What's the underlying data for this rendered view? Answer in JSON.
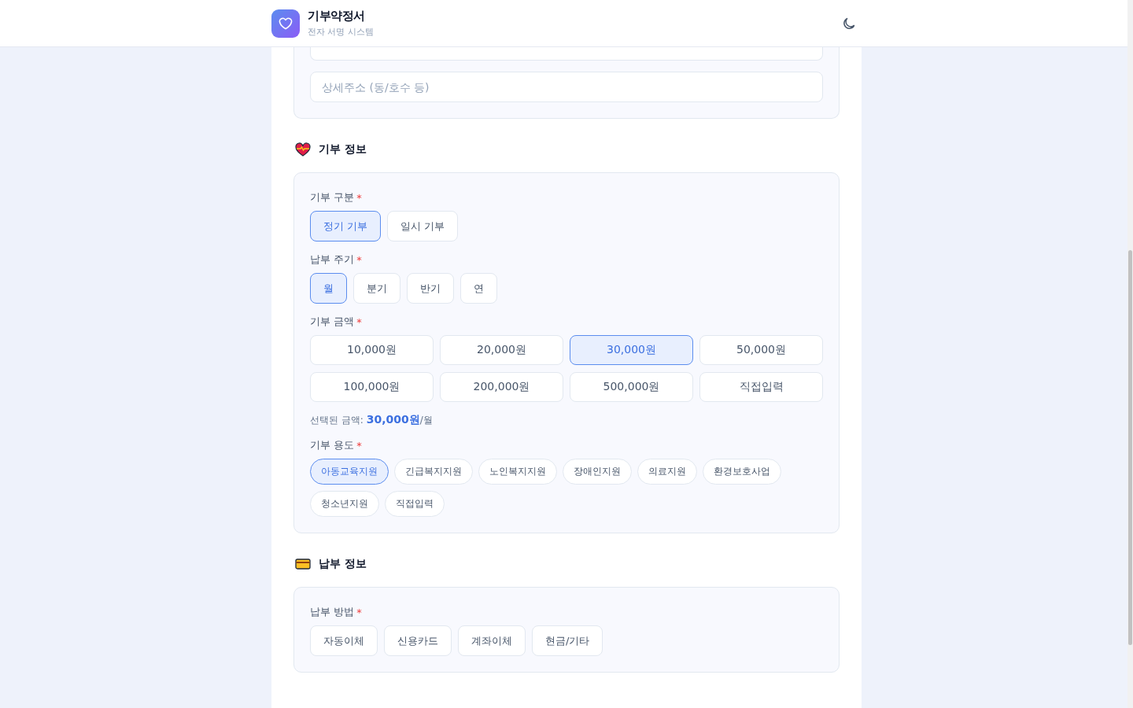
{
  "header": {
    "title": "기부약정서",
    "subtitle": "전자 서명 시스템"
  },
  "address": {
    "detail_placeholder": "상세주소 (동/호수 등)"
  },
  "sections": [
    {
      "title": "기부 정보",
      "kind": "heart",
      "groups": [
        {
          "kind": "buttons",
          "label": "기부 구분",
          "required_mark": "*",
          "options": [
            {
              "label": "정기 기부",
              "selected": true
            },
            {
              "label": "일시 기부",
              "selected": false
            }
          ]
        },
        {
          "kind": "buttons",
          "label": "납부 주기",
          "required_mark": "*",
          "options": [
            {
              "label": "월",
              "selected": true
            },
            {
              "label": "분기",
              "selected": false
            },
            {
              "label": "반기",
              "selected": false
            },
            {
              "label": "연",
              "selected": false
            }
          ]
        },
        {
          "kind": "grid",
          "label": "기부 금액",
          "required_mark": "*",
          "options": [
            {
              "label": "10,000원",
              "selected": false
            },
            {
              "label": "20,000원",
              "selected": false
            },
            {
              "label": "30,000원",
              "selected": true
            },
            {
              "label": "50,000원",
              "selected": false
            },
            {
              "label": "100,000원",
              "selected": false
            },
            {
              "label": "200,000원",
              "selected": false
            },
            {
              "label": "500,000원",
              "selected": false
            },
            {
              "label": "직접입력",
              "selected": false
            }
          ]
        },
        {
          "kind": "note",
          "text": "선택된 금액: **30,000원**/월"
        },
        {
          "kind": "pills",
          "label": "기부 용도",
          "required_mark": "*",
          "options": [
            {
              "label": "아동교육지원",
              "selected": true
            },
            {
              "label": "긴급복지지원",
              "selected": false
            },
            {
              "label": "노인복지지원",
              "selected": false
            },
            {
              "label": "장애인지원",
              "selected": false
            },
            {
              "label": "의료지원",
              "selected": false
            },
            {
              "label": "환경보호사업",
              "selected": false
            },
            {
              "label": "청소년지원",
              "selected": false
            },
            {
              "label": "직접입력",
              "selected": false
            }
          ]
        }
      ]
    },
    {
      "title": "납부 정보",
      "kind": "card",
      "groups": [
        {
          "kind": "buttons",
          "label": "납부 방법",
          "required_mark": "*",
          "options": [
            {
              "label": "자동이체",
              "selected": false
            },
            {
              "label": "신용카드",
              "selected": false
            },
            {
              "label": "계좌이체",
              "selected": false
            },
            {
              "label": "현금/기타",
              "selected": false
            }
          ]
        }
      ]
    }
  ]
}
